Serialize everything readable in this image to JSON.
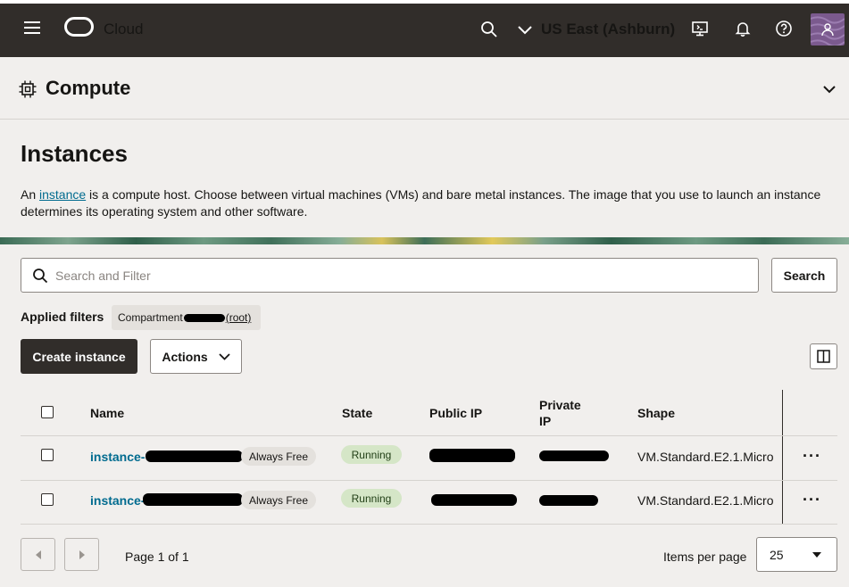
{
  "topbar": {
    "brand": "Cloud",
    "region": "US East (Ashburn)"
  },
  "service": {
    "title": "Compute"
  },
  "page": {
    "title": "Instances",
    "desc_prefix": "An ",
    "desc_link": "instance",
    "desc_rest": " is a compute host. Choose between virtual machines (VMs) and bare metal instances. The image that you use to launch an instance determines its operating system and other software."
  },
  "search": {
    "placeholder": "Search and Filter",
    "button": "Search"
  },
  "filters": {
    "label": "Applied filters",
    "chip_prefix": "Compartment",
    "chip_suffix": "(root)"
  },
  "toolbar": {
    "create": "Create instance",
    "actions": "Actions"
  },
  "table": {
    "headers": {
      "name": "Name",
      "state": "State",
      "public_ip": "Public IP",
      "private_ip_1": "Private",
      "private_ip_2": "IP",
      "shape": "Shape"
    },
    "rows": [
      {
        "name_prefix": "instance-",
        "badge": "Always Free",
        "state": "Running",
        "shape": "VM.Standard.E2.1.Micro",
        "more": "···"
      },
      {
        "name_prefix": "instance-",
        "badge": "Always Free",
        "state": "Running",
        "shape": "VM.Standard.E2.1.Micro",
        "more": "···"
      }
    ]
  },
  "pager": {
    "page_text": "Page 1 of 1",
    "ipp_label": "Items per page",
    "ipp_value": "25"
  },
  "icons": [
    "hamburger-icon",
    "oracle-logo-icon",
    "search-icon",
    "chevron-down-icon",
    "cloud-shell-icon",
    "bell-icon",
    "help-icon",
    "avatar",
    "chip-icon",
    "columns-icon",
    "ellipsis-icon",
    "chevron-left-icon",
    "chevron-right-icon"
  ]
}
